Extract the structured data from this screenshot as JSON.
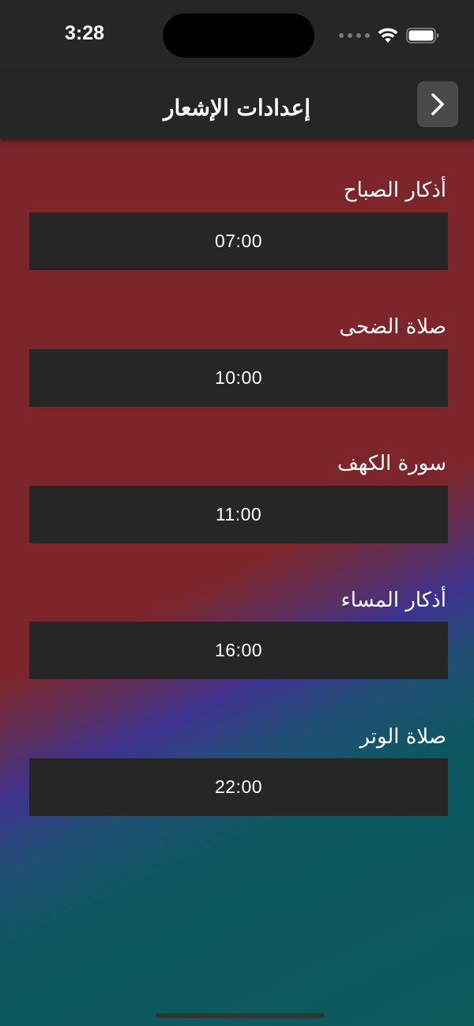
{
  "status_bar": {
    "time": "3:28"
  },
  "nav": {
    "title": "إعدادات الإشعار",
    "back_icon": "chevron-right-icon"
  },
  "notifications": [
    {
      "label": "أذكار الصباح",
      "time": "07:00"
    },
    {
      "label": "صلاة الضحى",
      "time": "10:00"
    },
    {
      "label": "سورة الكهف",
      "time": "11:00"
    },
    {
      "label": "أذكار المساء",
      "time": "16:00"
    },
    {
      "label": "صلاة الوتر",
      "time": "22:00"
    }
  ],
  "colors": {
    "bar_background": "#262626",
    "gradient_red": "#7c262c",
    "gradient_purple": "#3e3390",
    "gradient_teal": "#0b5a5c"
  }
}
